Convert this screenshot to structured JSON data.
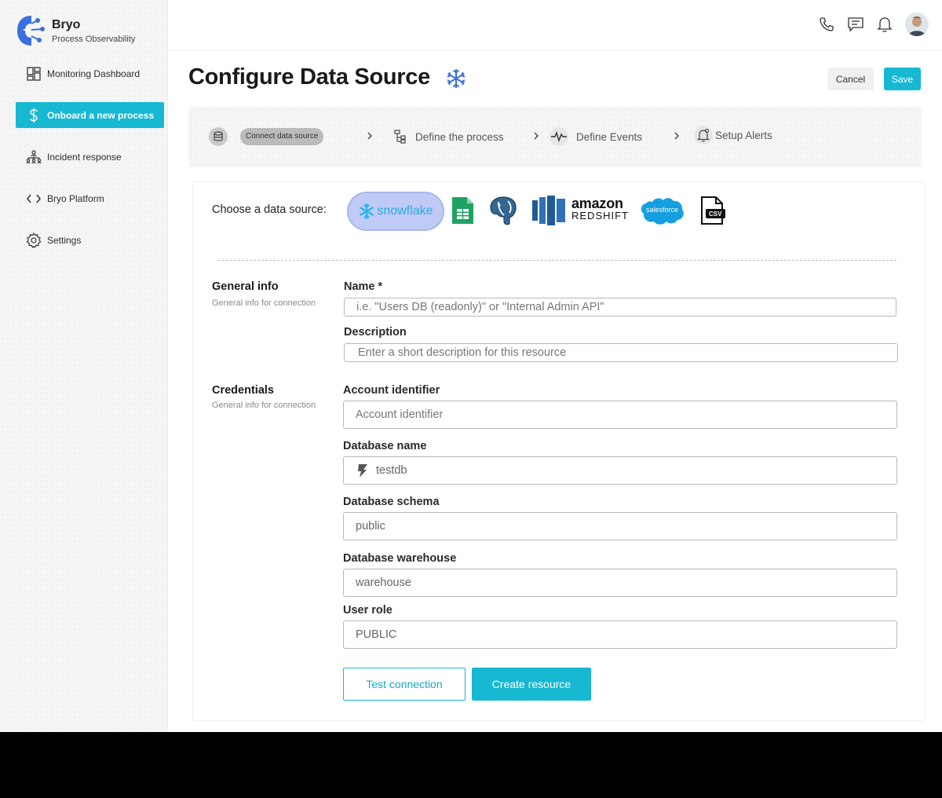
{
  "brand": {
    "name": "Bryo",
    "subtitle": "Process Observability"
  },
  "sidebar": {
    "items": [
      {
        "label": "Monitoring Dashboard",
        "icon": "dashboard-icon",
        "active": false
      },
      {
        "label": "Onboard a new process",
        "icon": "dollar-icon",
        "active": true
      },
      {
        "label": "Incident response",
        "icon": "hierarchy-icon",
        "active": false
      },
      {
        "label": "Bryo Platform",
        "icon": "code-icon",
        "active": false
      },
      {
        "label": "Settings",
        "icon": "gear-icon",
        "active": false
      }
    ]
  },
  "topbar": {
    "icons": [
      "phone-icon",
      "chat-icon",
      "bell-icon"
    ],
    "avatar": "avatar"
  },
  "header": {
    "title": "Configure Data Source",
    "cancel_label": "Cancel",
    "save_label": "Save"
  },
  "stepper": {
    "steps": [
      {
        "label": "Connect data source",
        "icon": "database-icon",
        "active": true
      },
      {
        "label": "Define the process",
        "icon": "process-icon",
        "active": false
      },
      {
        "label": "Define Events",
        "icon": "pulse-icon",
        "active": false
      },
      {
        "label": "Setup Alerts",
        "icon": "bell-alert-icon",
        "active": false
      }
    ]
  },
  "data_sources": {
    "label": "Choose a data source:",
    "snowflake_text": "snowflake",
    "redshift_top": "amazon",
    "redshift_bottom": "REDSHIFT",
    "salesforce_text": "salesforce",
    "csv_text": "CSV",
    "selected": "snowflake"
  },
  "general_info": {
    "title": "General info",
    "subtitle": "General info for connection",
    "name_label": "Name *",
    "name_placeholder": "i.e. \"Users DB (readonly)\" or \"Internal Admin API\"",
    "description_label": "Description",
    "description_placeholder": "Enter a short description for this resource"
  },
  "credentials": {
    "title": "Credentials",
    "subtitle": "General info for connection",
    "account_label": "Account identifier",
    "account_placeholder": "Account identifier",
    "dbname_label": "Database name",
    "dbname_value": "testdb",
    "schema_label": "Database schema",
    "schema_value": "public",
    "warehouse_label": "Database warehouse",
    "warehouse_value": "warehouse",
    "role_label": "User role",
    "role_value": "PUBLIC"
  },
  "actions": {
    "test_label": "Test connection",
    "create_label": "Create resource"
  },
  "colors": {
    "accent": "#17b8d2",
    "snowflake_blue": "#29b5e8",
    "selected_bg": "#bfcaf6"
  }
}
